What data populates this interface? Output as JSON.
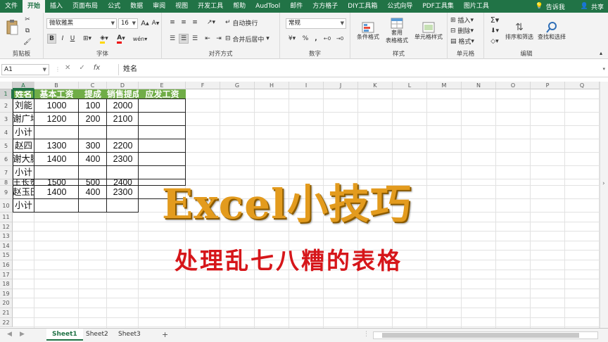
{
  "ribbon_tabs": [
    "文件",
    "开始",
    "插入",
    "页面布局",
    "公式",
    "数据",
    "审阅",
    "视图",
    "开发工具",
    "帮助",
    "AudTool",
    "邮件",
    "方方格子",
    "DIY工具箱",
    "公式向导",
    "PDF工具集",
    "图片工具"
  ],
  "active_tab": "开始",
  "tell_me": "告诉我",
  "share": "共享",
  "ribbon": {
    "clipboard_label": "剪贴板",
    "font_label": "字体",
    "font_name": "微软雅黑",
    "font_size": "16",
    "bold": "B",
    "italic": "I",
    "underline": "U",
    "wen": "wén",
    "align_label": "对齐方式",
    "wrap_text": "自动换行",
    "merge_center": "合并后居中",
    "number_label": "数字",
    "number_format": "常规",
    "percent": "%",
    "comma": ",",
    "styles_label": "样式",
    "cond_format": "条件格式",
    "table_format_1": "套用",
    "table_format_2": "表格格式",
    "cell_styles": "单元格样式",
    "cells_label": "单元格",
    "insert": "插入",
    "delete": "删除",
    "format": "格式",
    "edit_label": "编辑",
    "sort_filter": "排序和筛选",
    "find_select": "查找和选择"
  },
  "formula_bar": {
    "name_box": "A1",
    "fx": "fx",
    "value": "姓名"
  },
  "columns": [
    "A",
    "B",
    "C",
    "D",
    "E",
    "F",
    "G",
    "H",
    "I",
    "J",
    "K",
    "L",
    "M",
    "N",
    "O",
    "P",
    "Q"
  ],
  "rows": [
    "1",
    "2",
    "3",
    "4",
    "5",
    "6",
    "7",
    "8",
    "9",
    "10",
    "11",
    "12",
    "13",
    "14",
    "15",
    "16",
    "17",
    "18",
    "19",
    "20",
    "21",
    "22"
  ],
  "header_row": [
    "姓名",
    "基本工资",
    "提成",
    "销售提成",
    "应发工资"
  ],
  "table": [
    {
      "a": "刘能",
      "b": "1000",
      "c": "100",
      "d": "2000"
    },
    {
      "a": "谢广坤",
      "b": "1200",
      "c": "200",
      "d": "2100"
    },
    {
      "a": "小计",
      "b": "",
      "c": "",
      "d": ""
    },
    {
      "a": "赵四",
      "b": "1300",
      "c": "300",
      "d": "2200"
    },
    {
      "a": "谢大脚",
      "b": "1400",
      "c": "400",
      "d": "2300"
    },
    {
      "a": "小计",
      "b": "",
      "c": "",
      "d": ""
    },
    {
      "a": "王长贵",
      "b": "1500",
      "c": "500",
      "d": "2400"
    },
    {
      "a": "赵玉田",
      "b": "1400",
      "c": "400",
      "d": "2300"
    },
    {
      "a": "小计",
      "b": "",
      "c": "",
      "d": ""
    }
  ],
  "overlay": {
    "title": "Excel小技巧",
    "subtitle": "处理乱七八糟的表格"
  },
  "sheets": [
    "Sheet1",
    "Sheet2",
    "Sheet3"
  ],
  "add_sheet": "+",
  "colors": {
    "excel_green": "#217346",
    "header_fill": "#70ad47",
    "title": "#e39b1e",
    "subtitle": "#d6161a"
  }
}
